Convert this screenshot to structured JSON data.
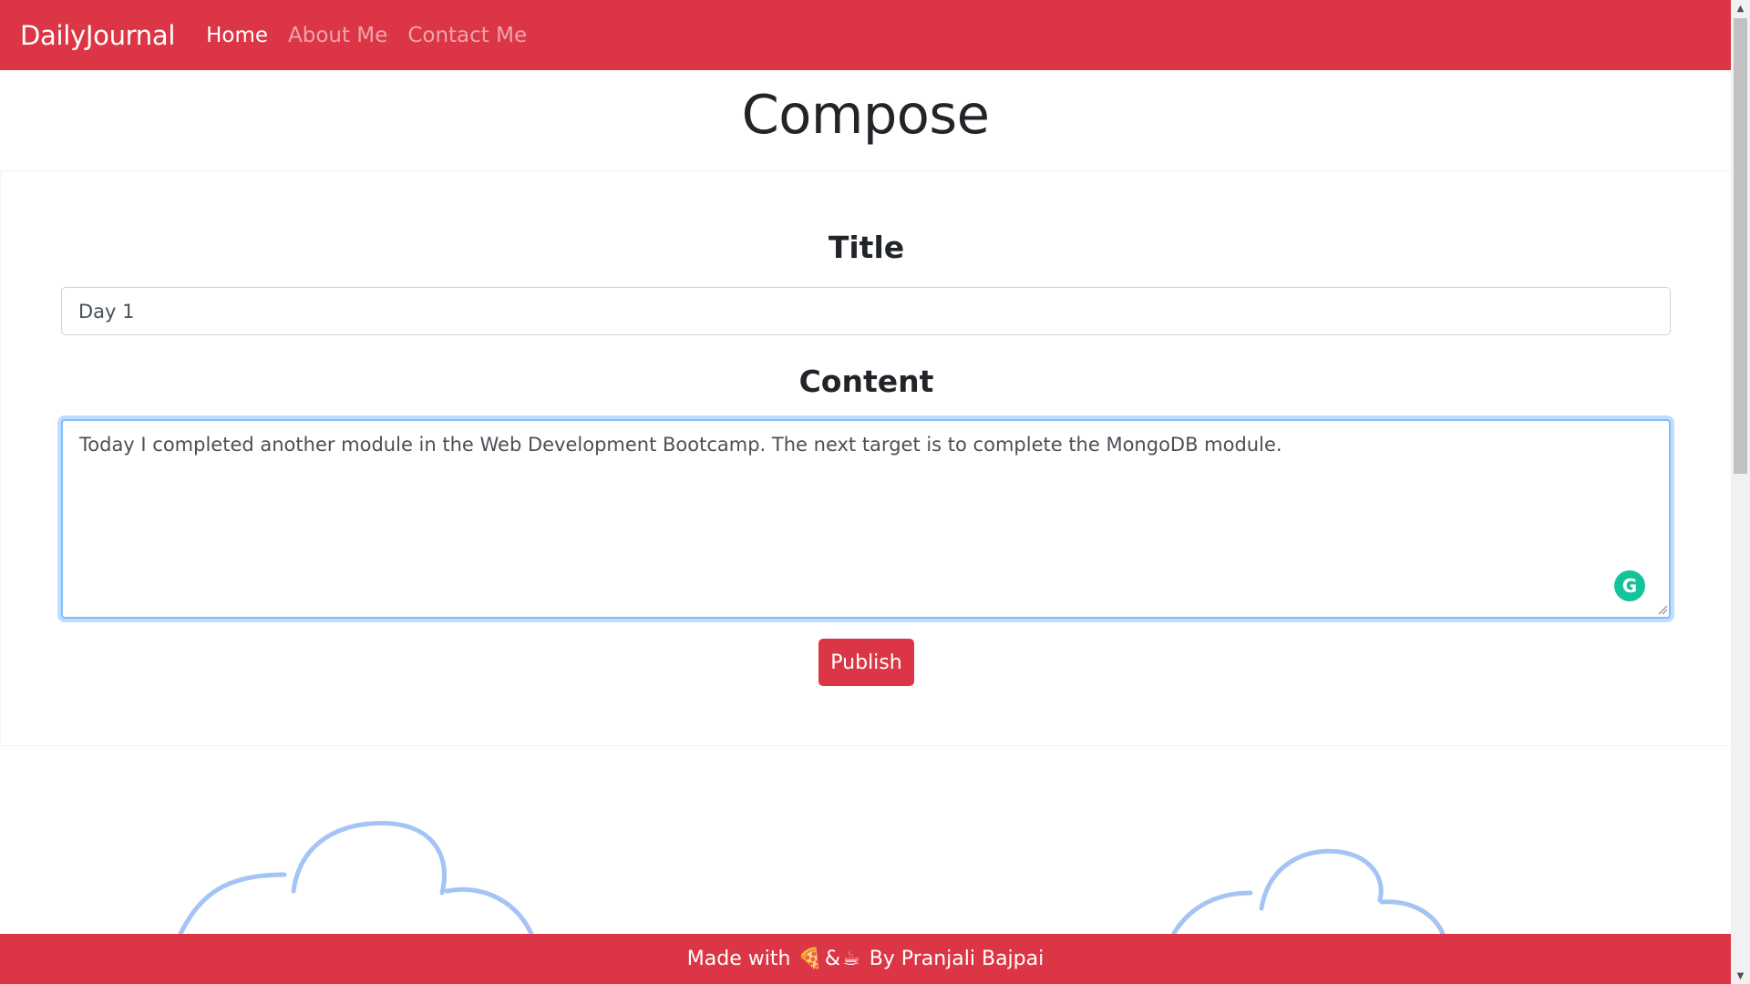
{
  "navbar": {
    "brand": "DailyJournal",
    "links": [
      {
        "label": "Home",
        "active": true
      },
      {
        "label": "About Me",
        "active": false
      },
      {
        "label": "Contact Me",
        "active": false
      }
    ]
  },
  "page": {
    "heading": "Compose"
  },
  "form": {
    "title_label": "Title",
    "title_value": "Day 1",
    "content_label": "Content",
    "content_value": "Today I completed another module in the Web Development Bootcamp. The next target is to complete the MongoDB module.",
    "publish_label": "Publish",
    "grammarly_glyph": "G"
  },
  "footer": {
    "prefix": "Made with",
    "icon_1": "🍕",
    "separator": "&",
    "icon_2": "☕",
    "suffix": "By Pranjali Bajpai"
  },
  "colors": {
    "accent": "#dc3545",
    "focus": "#80bdff",
    "grammarly": "#15c39a",
    "cloud": "#a4c4f5"
  }
}
